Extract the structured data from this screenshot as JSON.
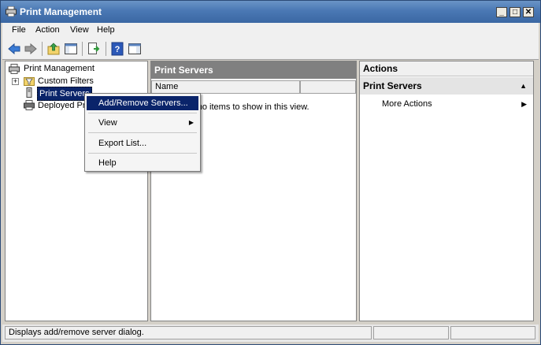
{
  "window": {
    "title": "Print Management"
  },
  "title_buttons": {
    "minimize": "_",
    "maximize": "□",
    "close": "✕"
  },
  "menubar": {
    "items": [
      "File",
      "Action",
      "View",
      "Help"
    ]
  },
  "toolbar": {
    "icons": [
      "back-arrow-icon",
      "forward-arrow-icon",
      "up-folder-icon",
      "show-hide-tree-icon",
      "export-list-icon",
      "help-icon",
      "show-hide-action-pane-icon"
    ]
  },
  "tree": {
    "root": "Print Management",
    "items": [
      "Custom Filters",
      "Print Servers",
      "Deployed Printers"
    ],
    "expander": "+"
  },
  "center": {
    "title": "Print Servers",
    "column": "Name",
    "empty_message": "There are no items to show in this view."
  },
  "actions": {
    "title": "Actions",
    "section": "Print Servers",
    "collapse_arrow": "▲",
    "more": "More Actions",
    "more_arrow": "▶"
  },
  "context_menu": {
    "items": [
      {
        "label": "Add/Remove Servers...",
        "highlighted": true
      },
      {
        "label": "View",
        "submenu": "▶"
      },
      {
        "label": "Export List..."
      },
      {
        "label": "Help"
      }
    ]
  },
  "statusbar": {
    "text": "Displays add/remove server dialog."
  },
  "colors": {
    "title_bar": "#4a78b4",
    "highlight": "#0a246a",
    "pane_header": "#808080"
  }
}
